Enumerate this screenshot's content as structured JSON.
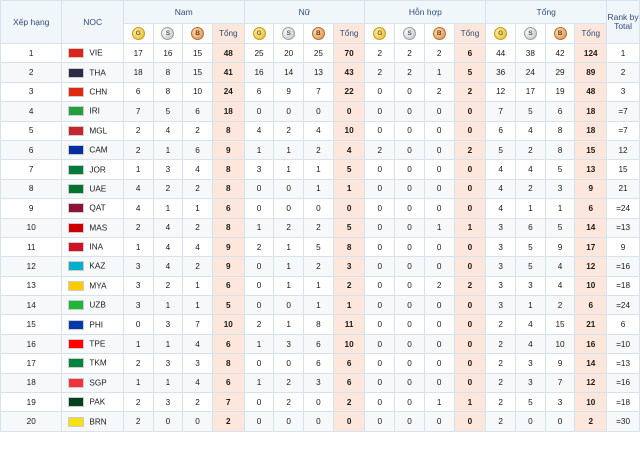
{
  "headers": {
    "rank": "Xếp hạng",
    "noc": "NOC",
    "groups": [
      "Nam",
      "Nữ",
      "Hỗn hợp",
      "Tổng"
    ],
    "rank_by_total": "Rank by Total",
    "medal_letters": [
      "G",
      "S",
      "B"
    ],
    "total": "Tổng"
  },
  "colors": {
    "header_bg": "#f1f6fb",
    "total_col": "#fde6dc",
    "grid": "#d6e2ee"
  },
  "rows": [
    {
      "rank": "1",
      "code": "VIE",
      "flag": "#da251d",
      "m": [
        "17",
        "16",
        "15",
        "48"
      ],
      "w": [
        "25",
        "20",
        "25",
        "70"
      ],
      "x": [
        "2",
        "2",
        "2",
        "6"
      ],
      "t": [
        "44",
        "38",
        "42",
        "124"
      ],
      "rt": "1"
    },
    {
      "rank": "2",
      "code": "THA",
      "flag": "#2d2a4a",
      "m": [
        "18",
        "8",
        "15",
        "41"
      ],
      "w": [
        "16",
        "14",
        "13",
        "43"
      ],
      "x": [
        "2",
        "2",
        "1",
        "5"
      ],
      "t": [
        "36",
        "24",
        "29",
        "89"
      ],
      "rt": "2"
    },
    {
      "rank": "3",
      "code": "CHN",
      "flag": "#de2910",
      "m": [
        "6",
        "8",
        "10",
        "24"
      ],
      "w": [
        "6",
        "9",
        "7",
        "22"
      ],
      "x": [
        "0",
        "0",
        "2",
        "2"
      ],
      "t": [
        "12",
        "17",
        "19",
        "48"
      ],
      "rt": "3"
    },
    {
      "rank": "4",
      "code": "IRI",
      "flag": "#239f40",
      "m": [
        "7",
        "5",
        "6",
        "18"
      ],
      "w": [
        "0",
        "0",
        "0",
        "0"
      ],
      "x": [
        "0",
        "0",
        "0",
        "0"
      ],
      "t": [
        "7",
        "5",
        "6",
        "18"
      ],
      "rt": "=7"
    },
    {
      "rank": "5",
      "code": "MGL",
      "flag": "#c4272f",
      "m": [
        "2",
        "4",
        "2",
        "8"
      ],
      "w": [
        "4",
        "2",
        "4",
        "10"
      ],
      "x": [
        "0",
        "0",
        "0",
        "0"
      ],
      "t": [
        "6",
        "4",
        "8",
        "18"
      ],
      "rt": "=7"
    },
    {
      "rank": "6",
      "code": "CAM",
      "flag": "#032ea1",
      "m": [
        "2",
        "1",
        "6",
        "9"
      ],
      "w": [
        "1",
        "1",
        "2",
        "4"
      ],
      "x": [
        "2",
        "0",
        "0",
        "2"
      ],
      "t": [
        "5",
        "2",
        "8",
        "15"
      ],
      "rt": "12"
    },
    {
      "rank": "7",
      "code": "JOR",
      "flag": "#007a3d",
      "m": [
        "1",
        "3",
        "4",
        "8"
      ],
      "w": [
        "3",
        "1",
        "1",
        "5"
      ],
      "x": [
        "0",
        "0",
        "0",
        "0"
      ],
      "t": [
        "4",
        "4",
        "5",
        "13"
      ],
      "rt": "15"
    },
    {
      "rank": "8",
      "code": "UAE",
      "flag": "#00732f",
      "m": [
        "4",
        "2",
        "2",
        "8"
      ],
      "w": [
        "0",
        "0",
        "1",
        "1"
      ],
      "x": [
        "0",
        "0",
        "0",
        "0"
      ],
      "t": [
        "4",
        "2",
        "3",
        "9"
      ],
      "rt": "21"
    },
    {
      "rank": "9",
      "code": "QAT",
      "flag": "#8a1538",
      "m": [
        "4",
        "1",
        "1",
        "6"
      ],
      "w": [
        "0",
        "0",
        "0",
        "0"
      ],
      "x": [
        "0",
        "0",
        "0",
        "0"
      ],
      "t": [
        "4",
        "1",
        "1",
        "6"
      ],
      "rt": "=24"
    },
    {
      "rank": "10",
      "code": "MAS",
      "flag": "#cc0001",
      "m": [
        "2",
        "4",
        "2",
        "8"
      ],
      "w": [
        "1",
        "2",
        "2",
        "5"
      ],
      "x": [
        "0",
        "0",
        "1",
        "1"
      ],
      "t": [
        "3",
        "6",
        "5",
        "14"
      ],
      "rt": "=13"
    },
    {
      "rank": "11",
      "code": "INA",
      "flag": "#ce1126",
      "m": [
        "1",
        "4",
        "4",
        "9"
      ],
      "w": [
        "2",
        "1",
        "5",
        "8"
      ],
      "x": [
        "0",
        "0",
        "0",
        "0"
      ],
      "t": [
        "3",
        "5",
        "9",
        "17"
      ],
      "rt": "9"
    },
    {
      "rank": "12",
      "code": "KAZ",
      "flag": "#00afca",
      "m": [
        "3",
        "4",
        "2",
        "9"
      ],
      "w": [
        "0",
        "1",
        "2",
        "3"
      ],
      "x": [
        "0",
        "0",
        "0",
        "0"
      ],
      "t": [
        "3",
        "5",
        "4",
        "12"
      ],
      "rt": "=16"
    },
    {
      "rank": "13",
      "code": "MYA",
      "flag": "#fecb00",
      "m": [
        "3",
        "2",
        "1",
        "6"
      ],
      "w": [
        "0",
        "1",
        "1",
        "2"
      ],
      "x": [
        "0",
        "0",
        "2",
        "2"
      ],
      "t": [
        "3",
        "3",
        "4",
        "10"
      ],
      "rt": "=18"
    },
    {
      "rank": "14",
      "code": "UZB",
      "flag": "#1eb53a",
      "m": [
        "3",
        "1",
        "1",
        "5"
      ],
      "w": [
        "0",
        "0",
        "1",
        "1"
      ],
      "x": [
        "0",
        "0",
        "0",
        "0"
      ],
      "t": [
        "3",
        "1",
        "2",
        "6"
      ],
      "rt": "=24"
    },
    {
      "rank": "15",
      "code": "PHI",
      "flag": "#0038a8",
      "m": [
        "0",
        "3",
        "7",
        "10"
      ],
      "w": [
        "2",
        "1",
        "8",
        "11"
      ],
      "x": [
        "0",
        "0",
        "0",
        "0"
      ],
      "t": [
        "2",
        "4",
        "15",
        "21"
      ],
      "rt": "6"
    },
    {
      "rank": "16",
      "code": "TPE",
      "flag": "#fe0000",
      "m": [
        "1",
        "1",
        "4",
        "6"
      ],
      "w": [
        "1",
        "3",
        "6",
        "10"
      ],
      "x": [
        "0",
        "0",
        "0",
        "0"
      ],
      "t": [
        "2",
        "4",
        "10",
        "16"
      ],
      "rt": "=10"
    },
    {
      "rank": "17",
      "code": "TKM",
      "flag": "#00843d",
      "m": [
        "2",
        "3",
        "3",
        "8"
      ],
      "w": [
        "0",
        "0",
        "6",
        "6"
      ],
      "x": [
        "0",
        "0",
        "0",
        "0"
      ],
      "t": [
        "2",
        "3",
        "9",
        "14"
      ],
      "rt": "=13"
    },
    {
      "rank": "18",
      "code": "SGP",
      "flag": "#ef3340",
      "m": [
        "1",
        "1",
        "4",
        "6"
      ],
      "w": [
        "1",
        "2",
        "3",
        "6"
      ],
      "x": [
        "0",
        "0",
        "0",
        "0"
      ],
      "t": [
        "2",
        "3",
        "7",
        "12"
      ],
      "rt": "=16"
    },
    {
      "rank": "19",
      "code": "PAK",
      "flag": "#01411c",
      "m": [
        "2",
        "3",
        "2",
        "7"
      ],
      "w": [
        "0",
        "2",
        "0",
        "2"
      ],
      "x": [
        "0",
        "0",
        "1",
        "1"
      ],
      "t": [
        "2",
        "5",
        "3",
        "10"
      ],
      "rt": "=18"
    },
    {
      "rank": "20",
      "code": "BRN",
      "flag": "#f7e017",
      "m": [
        "2",
        "0",
        "0",
        "2"
      ],
      "w": [
        "0",
        "0",
        "0",
        "0"
      ],
      "x": [
        "0",
        "0",
        "0",
        "0"
      ],
      "t": [
        "2",
        "0",
        "0",
        "2"
      ],
      "rt": "=30"
    }
  ]
}
